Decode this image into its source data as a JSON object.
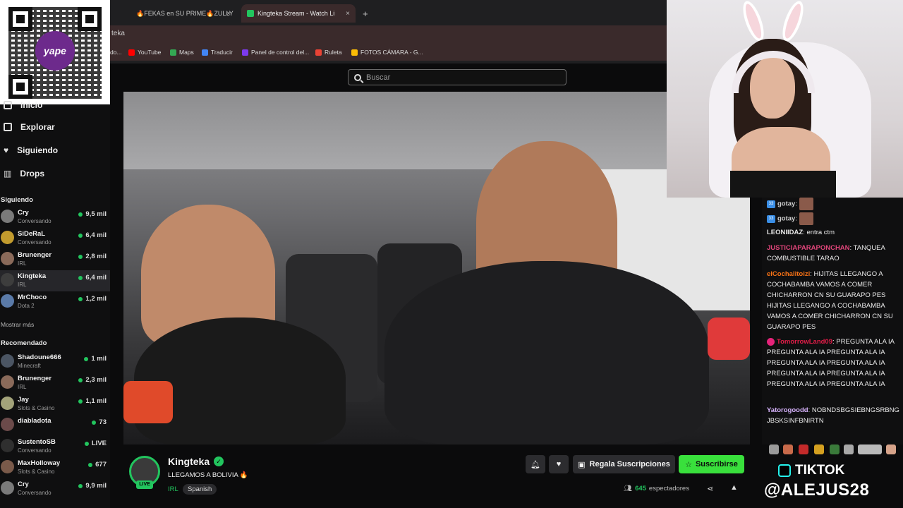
{
  "browser": {
    "tabs": [
      {
        "label": "🔥FEKAS en SU PRIME🔥ZULLY",
        "active": false
      },
      {
        "label": "Kingteka Stream - Watch Li",
        "active": true
      }
    ],
    "new_tab": "+",
    "close_glyph": "×",
    "url_text": "teka",
    "bookmarks": [
      {
        "label": "do...",
        "color": "#f2f2f2"
      },
      {
        "label": "YouTube",
        "color": "#ff0000"
      },
      {
        "label": "Maps",
        "color": "#34a853"
      },
      {
        "label": "Traducir",
        "color": "#4285f4"
      },
      {
        "label": "Panel de control del...",
        "color": "#7c3aed"
      },
      {
        "label": "Ruleta",
        "color": "#ea4335"
      },
      {
        "label": "FOTOS CÁMARA - G...",
        "color": "#fbbc05"
      }
    ]
  },
  "qr": {
    "brand": "yape"
  },
  "sidebar": {
    "nav": [
      {
        "label": "Inicio",
        "icon": "home-icon"
      },
      {
        "label": "Explorar",
        "icon": "compass-icon"
      },
      {
        "label": "Siguiendo",
        "icon": "heart-icon"
      },
      {
        "label": "Drops",
        "icon": "chart-icon"
      }
    ],
    "following_title": "Siguiendo",
    "following": [
      {
        "name": "Cry",
        "sub": "Conversando",
        "viewers": "9,5 mil",
        "color": "#7a7a7a"
      },
      {
        "name": "SiDeRaL",
        "sub": "Conversando",
        "viewers": "6,4 mil",
        "color": "#c29b2e"
      },
      {
        "name": "Brunenger",
        "sub": "IRL",
        "viewers": "2,8 mil",
        "color": "#8a6a5a"
      },
      {
        "name": "Kingteka",
        "sub": "IRL",
        "viewers": "6,4 mil",
        "color": "#3d3d3d",
        "selected": true
      },
      {
        "name": "MrChoco",
        "sub": "Dota 2",
        "viewers": "1,2 mil",
        "color": "#5a7aa8"
      }
    ],
    "more": "Mostrar más",
    "recommended_title": "Recomendado",
    "recommended": [
      {
        "name": "Shadoune666",
        "sub": "Minecraft",
        "viewers": "1 mil",
        "color": "#4b5563"
      },
      {
        "name": "Brunenger",
        "sub": "IRL",
        "viewers": "2,3 mil",
        "color": "#8a6a5a"
      },
      {
        "name": "Jay",
        "sub": "Slots & Casino",
        "viewers": "1,1 mil",
        "color": "#a3a37a"
      },
      {
        "name": "diabladota",
        "sub": "",
        "viewers": "73",
        "color": "#6b4a4a"
      },
      {
        "name": "SustentoSB",
        "sub": "Conversando",
        "viewers": "LIVE",
        "color": "#2f2f2f"
      },
      {
        "name": "MaxHolloway",
        "sub": "Slots & Casino",
        "viewers": "677",
        "color": "#7a5a4a"
      },
      {
        "name": "Cry",
        "sub": "Conversando",
        "viewers": "9,9 mil",
        "color": "#7a7a7a"
      }
    ]
  },
  "search": {
    "placeholder": "Buscar"
  },
  "stream": {
    "channel": "Kingteka",
    "live": "LIVE",
    "title": "LLEGAMOS A BOLIVIA 🔥",
    "category": "IRL",
    "language": "Spanish",
    "gift_label": "Regala Suscripciones",
    "subscribe_label": "Suscribirse",
    "viewers": "645",
    "viewers_label": "espectadores"
  },
  "chat": {
    "messages": [
      {
        "user": "gotay",
        "text": "",
        "color": "#cfcfcf"
      },
      {
        "user": "gotay",
        "text": "",
        "color": "#cfcfcf"
      },
      {
        "user": "LEONIIDAZ",
        "text": "entra ctm",
        "color": "#e8e8e8"
      },
      {
        "user": "JUSTICIAPARAPONCHAN",
        "text": "TANQUEA COMBUSTIBLE TARAO",
        "color": "#e0457a"
      },
      {
        "user": "elCochalitoizi",
        "text": "HIJITAS LLEGANGO A COCHABAMBA VAMOS A COMER CHICHARRON CN SU GUARAPO PES HIJITAS LLEGANGO A COCHABAMBA VAMOS A COMER CHICHARRON CN SU GUARAPO PES",
        "color": "#f97316"
      },
      {
        "user": "TomorrowLand09",
        "text": "PREGUNTA ALA IA PREGUNTA ALA IA PREGUNTA ALA IA PREGUNTA ALA IA PREGUNTA ALA IA PREGUNTA ALA IA PREGUNTA ALA IA PREGUNTA ALA IA PREGUNTA ALA IA",
        "color": "#e11d48"
      },
      {
        "user": "Yatorogoodd",
        "text": "NOBNDSBGSIEBNGSRBNGJBSKSINFBNIRTN",
        "color": "#d8b4fe"
      }
    ]
  },
  "overlay": {
    "tiktok": "TIKTOK",
    "handle": "@ALEJUS28"
  }
}
